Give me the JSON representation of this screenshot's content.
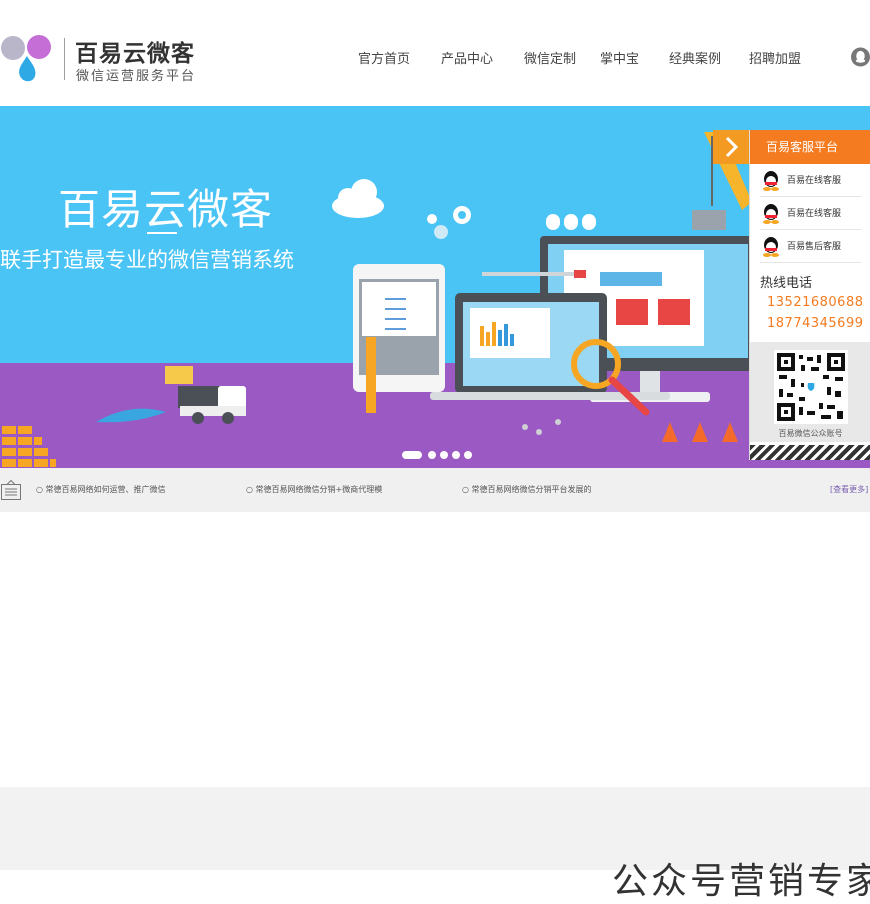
{
  "brand": {
    "title": "百易云微客",
    "subtitle": "微信运营服务平台",
    "colors": {
      "petal_left": "#b9b6c9",
      "petal_right": "#c56fd6",
      "drop": "#2fa9e6"
    }
  },
  "nav": {
    "items": [
      {
        "label": "官方首页"
      },
      {
        "label": "产品中心"
      },
      {
        "label": "微信定制"
      },
      {
        "label": "掌中宝"
      },
      {
        "label": "经典案例"
      },
      {
        "label": "招聘加盟"
      }
    ],
    "right_icon": "qq-penguin-icon"
  },
  "banner": {
    "title": "百易云微客",
    "subtitle": "联手打造最专业的微信营销系统",
    "colors": {
      "sky": "#4ac3f5",
      "ground": "#9b59c4"
    },
    "slide_count": 5,
    "active_slide": 1
  },
  "service_panel": {
    "header": "百易客服平台",
    "toggle_icon": "chevron-right-icon",
    "items": [
      {
        "label": "百易在线客服",
        "icon": "qq-penguin-icon"
      },
      {
        "label": "百易在线客服",
        "icon": "qq-penguin-icon"
      },
      {
        "label": "百易售后客服",
        "icon": "qq-penguin-icon"
      }
    ],
    "hotline_label": "热线电话",
    "phones": [
      "13521680688",
      "18774345699"
    ],
    "qr_caption": "百易微信公众账号",
    "colors": {
      "accent": "#f47b20",
      "toggle": "#f39a22"
    }
  },
  "news": {
    "icon": "notice-board-icon",
    "items": [
      "○ 常德百易网络如何运营、推广微信",
      "○ 常德百易网络微信分销+微商代理模",
      "○ 常德百易网络微信分销平台发展的"
    ],
    "more": "[查看更多]"
  },
  "section": {
    "title": "公众号营销专家"
  }
}
